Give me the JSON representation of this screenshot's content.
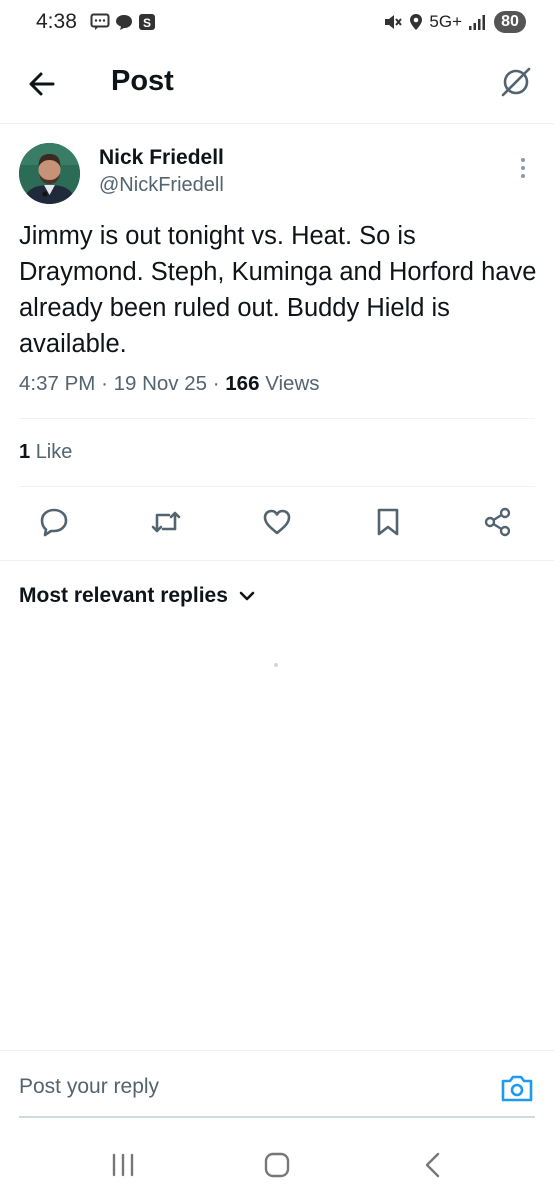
{
  "status_bar": {
    "time": "4:38",
    "network": "5G+",
    "battery": "80",
    "icons_left": [
      "message-icon",
      "chat-icon",
      "s-app-icon"
    ],
    "icons_right": [
      "mute-icon",
      "location-icon",
      "signal-icon"
    ]
  },
  "header": {
    "title": "Post",
    "back_icon": "arrow-left-icon",
    "grok_icon": "grok-icon"
  },
  "post": {
    "author_name": "Nick Friedell",
    "author_handle": "@NickFriedell",
    "text": "Jimmy is out tonight vs. Heat. So is Draymond. Steph, Kuminga and Horford have already been ruled out. Buddy Hield is available.",
    "time": "4:37 PM",
    "date": "19 Nov 25",
    "views_count": "166",
    "views_label": "Views",
    "likes_count": "1",
    "likes_label": "Like"
  },
  "actions": [
    "reply-icon",
    "repost-icon",
    "like-icon",
    "bookmark-icon",
    "share-icon"
  ],
  "replies": {
    "sort_label": "Most relevant replies"
  },
  "composer": {
    "placeholder": "Post your reply"
  },
  "nav": [
    "recents-icon",
    "home-icon",
    "back-icon"
  ],
  "colors": {
    "primary_text": "#0f1419",
    "secondary_text": "#536471",
    "accent": "#1d9bf0",
    "divider": "#eff3f4"
  }
}
